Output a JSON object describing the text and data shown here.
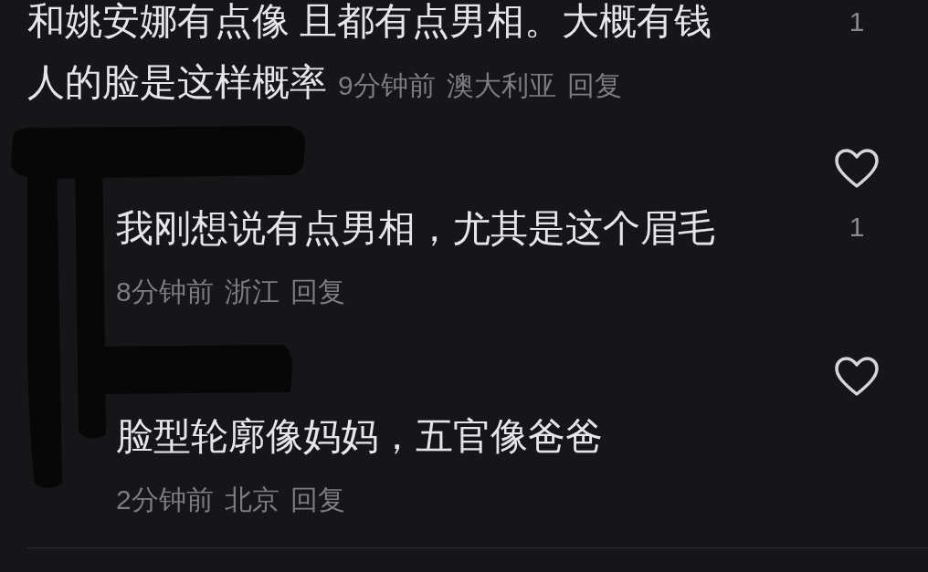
{
  "comments": [
    {
      "kind": "comment",
      "lines": [
        "和姚安娜有点像 且都有点男相。大概有钱",
        "人的脸是这样概率"
      ],
      "time": "9分钟前",
      "location": "澳大利亚",
      "reply_label": "回复",
      "likes": "1"
    },
    {
      "kind": "reply",
      "text": "我刚想说有点男相，尤其是这个眉毛",
      "time": "8分钟前",
      "location": "浙江",
      "reply_label": "回复",
      "likes": "1"
    },
    {
      "kind": "reply",
      "text": "脸型轮廓像妈妈，五官像爸爸",
      "time": "2分钟前",
      "location": "北京",
      "reply_label": "回复"
    }
  ]
}
